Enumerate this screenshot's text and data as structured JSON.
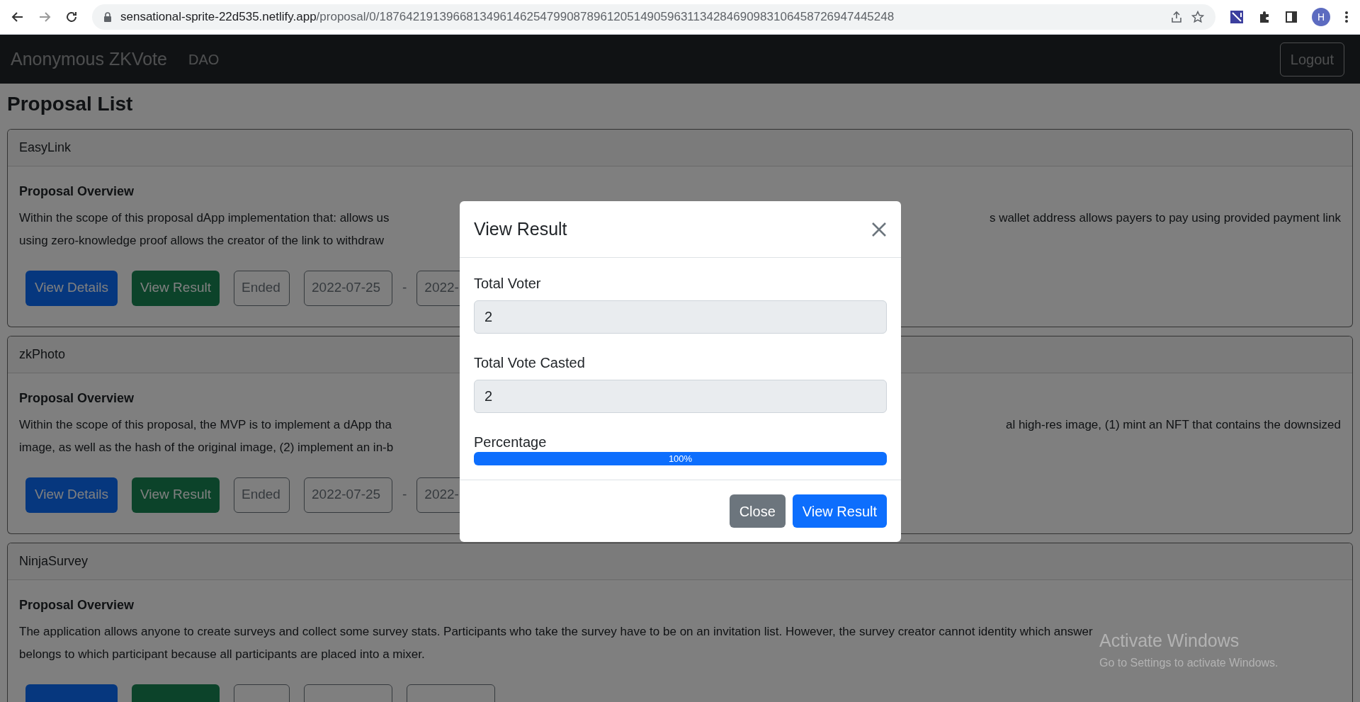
{
  "browser": {
    "url_host": "sensational-sprite-22d535.netlify.app",
    "url_path": "/proposal/0/18764219139668134961462547990878961205149059631134284690983106458726947445248",
    "profile_initial": "H"
  },
  "navbar": {
    "brand": "Anonymous ZKVote",
    "links": [
      "DAO"
    ],
    "logout": "Logout"
  },
  "heading": "Proposal List",
  "proposals": [
    {
      "title": "EasyLink",
      "overview_label": "Proposal Overview",
      "lines": [
        {
          "left": "Within the scope of this proposal dApp implementation that: allows us",
          "right": "s wallet address allows payers to pay using provided payment link"
        },
        {
          "left": "using zero-knowledge proof allows the creator of the link to withdraw"
        }
      ],
      "details_button": "View Details",
      "result_button": "View Result",
      "status": "Ended",
      "start": "2022-07-25",
      "separator": "-",
      "end": "2022-"
    },
    {
      "title": "zkPhoto",
      "overview_label": "Proposal Overview",
      "lines": [
        {
          "left": "Within the scope of this proposal, the MVP is to implement a dApp tha",
          "right": "al high-res image, (1) mint an NFT that contains the downsized"
        },
        {
          "left": "image, as well as the hash of the original image, (2) implement an in-b"
        }
      ],
      "details_button": "View Details",
      "result_button": "View Result",
      "status": "Ended",
      "start": "2022-07-25",
      "separator": "-",
      "end": "2022-"
    },
    {
      "title": "NinjaSurvey",
      "overview_label": "Proposal Overview",
      "lines": [
        {
          "left": "The application allows anyone to create surveys and collect some survey stats. Participants who take the survey have to be on an invitation list. However, the survey creator cannot identity which answer"
        },
        {
          "left": "belongs to which participant because all participants are placed into a mixer."
        }
      ]
    }
  ],
  "modal": {
    "title": "View Result",
    "fields": [
      {
        "label": "Total Voter",
        "value": "2"
      },
      {
        "label": "Total Vote Casted",
        "value": "2"
      }
    ],
    "progress_label": "Percentage",
    "progress": {
      "level": 1,
      "text": "100%"
    },
    "close_button": "Close",
    "result_button": "View Result"
  },
  "os_notice": {
    "title": "Activate Windows",
    "text": "Go to Settings to activate Windows."
  }
}
